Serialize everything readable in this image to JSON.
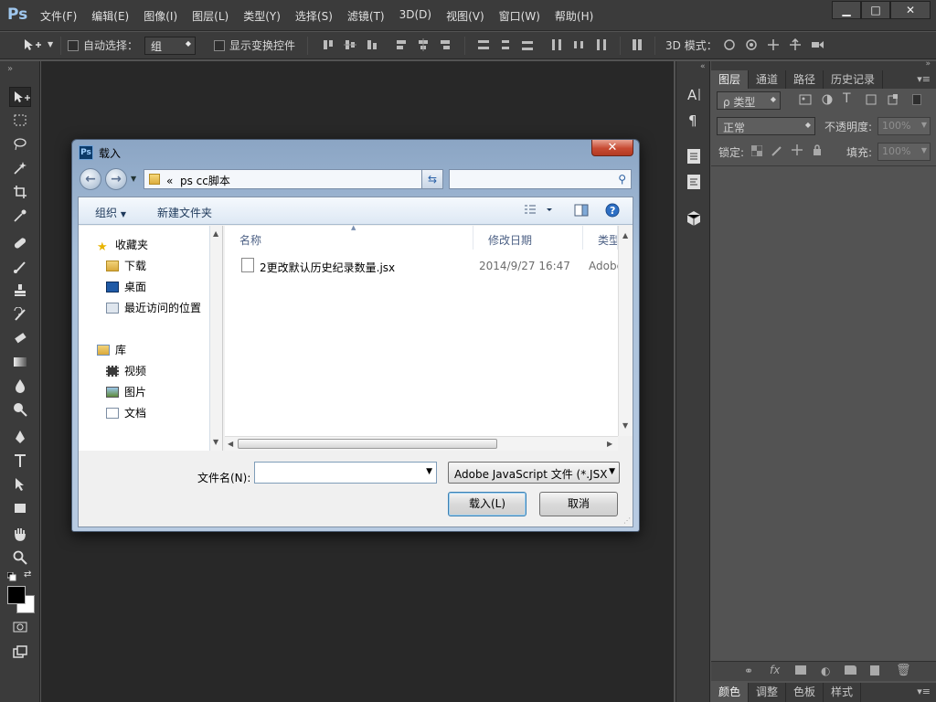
{
  "app": {
    "logo": "Ps",
    "menu": [
      "文件(F)",
      "编辑(E)",
      "图像(I)",
      "图层(L)",
      "类型(Y)",
      "选择(S)",
      "滤镜(T)",
      "3D(D)",
      "视图(V)",
      "窗口(W)",
      "帮助(H)"
    ],
    "window_buttons": {
      "minimize": "▁",
      "maximize": "□",
      "close": "✕"
    }
  },
  "options": {
    "auto_select_label": "自动选择：",
    "auto_select_value": "组",
    "show_transform_label": "显示变换控件",
    "mode_3d_label": "3D 模式："
  },
  "panel": {
    "tabs": [
      "图层",
      "通道",
      "路径",
      "历史记录"
    ],
    "filter_kind": "ρ 类型",
    "blend_mode": "正常",
    "opacity_label": "不透明度:",
    "opacity_value": "100%",
    "lock_label": "锁定:",
    "fill_label": "填充:",
    "fill_value": "100%",
    "bottom_tabs": [
      "颜色",
      "调整",
      "色板",
      "样式"
    ]
  },
  "dialog": {
    "title": "载入",
    "address_prefix": "«",
    "address": "ps cc脚本",
    "organize": "组织",
    "new_folder": "新建文件夹",
    "nav": {
      "favorites": "收藏夹",
      "downloads": "下载",
      "desktop": "桌面",
      "recent": "最近访问的位置",
      "libraries": "库",
      "videos": "视频",
      "pictures": "图片",
      "documents": "文档"
    },
    "columns": {
      "name": "名称",
      "date": "修改日期",
      "type": "类型"
    },
    "files": [
      {
        "name": "2更改默认历史纪录数量.jsx",
        "date": "2014/9/27 16:47",
        "type": "Adobe"
      }
    ],
    "filename_label": "文件名(N):",
    "filename_value": "",
    "filetype": "Adobe JavaScript 文件 (*.JSX",
    "load_button": "载入(L)",
    "cancel_button": "取消"
  }
}
